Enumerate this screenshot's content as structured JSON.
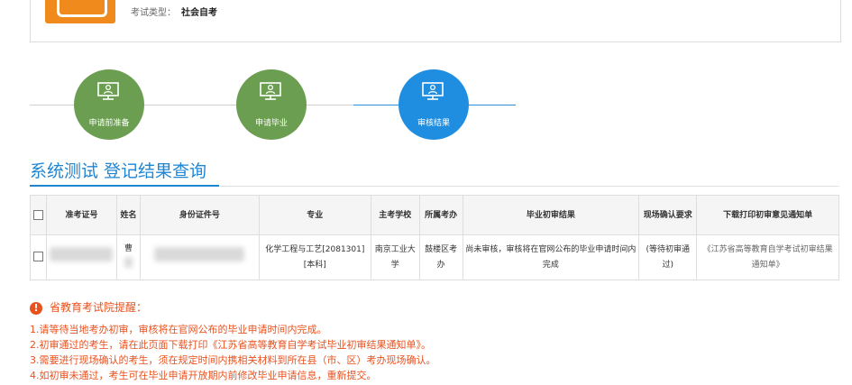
{
  "header": {
    "exam_type_label": "考试类型：",
    "exam_type_value": "社会自考",
    "brand_color": "#f08a1c"
  },
  "steps": [
    {
      "label": "申请前准备",
      "state": "done",
      "icon": "monitor-user-icon"
    },
    {
      "label": "申请毕业",
      "state": "done",
      "icon": "monitor-user-icon"
    },
    {
      "label": "审核结果",
      "state": "active",
      "icon": "monitor-user-icon"
    }
  ],
  "colors": {
    "step_done": "#6b9e51",
    "step_active": "#1f8ee0",
    "accent": "#1f86d4",
    "warning": "#e8521f"
  },
  "page_title": {
    "main": "系统测试",
    "sub": "登记结果查询"
  },
  "table": {
    "headers": {
      "admission_no": "准考证号",
      "name": "姓名",
      "id_no": "身份证件号",
      "major": "专业",
      "school": "主考学校",
      "exam_office": "所属考办",
      "initial_result": "毕业初审结果",
      "onsite": "现场确认要求",
      "download": "下载打印初审意见通知单"
    },
    "rows": [
      {
        "admission_no": "",
        "name": "曹",
        "id_no": "",
        "major": "化学工程与工艺[2081301][本科]",
        "school": "南京工业大学",
        "exam_office": "鼓楼区考办",
        "initial_result": "尚未审核，审核将在官网公布的毕业申请时间内完成",
        "onsite": "(等待初审通过)",
        "download": "《江苏省高等教育自学考试初审结果通知单》"
      }
    ]
  },
  "reminder": {
    "title": "省教育考试院提醒：",
    "items": [
      "1.请等待当地考办初审，审核将在官网公布的毕业申请时间内完成。",
      "2.初审通过的考生，请在此页面下载打印《江苏省高等教育自学考试毕业初审结果通知单》。",
      "3.需要进行现场确认的考生，须在规定时间内携相关材料到所在县（市、区）考办现场确认。",
      "4.如初审未通过，考生可在毕业申请开放期内前修改毕业申请信息，重新提交。"
    ]
  }
}
